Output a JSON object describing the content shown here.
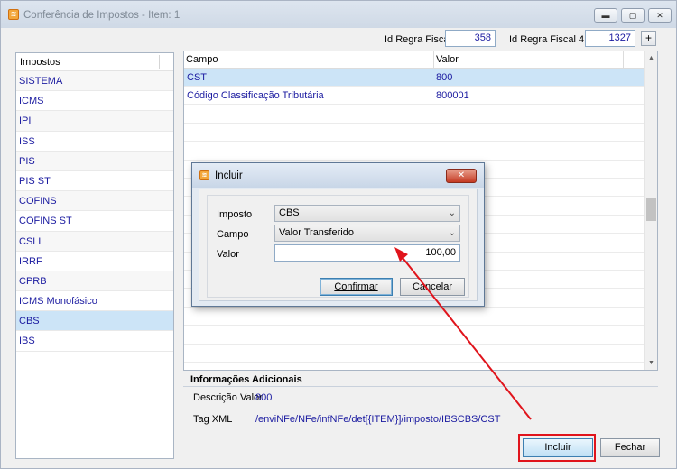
{
  "window": {
    "title": "Conferência de Impostos - Item: 1",
    "app_icon": "app-logo-icon",
    "controls": [
      "minimize-icon",
      "maximize-icon",
      "close-icon"
    ]
  },
  "top": {
    "regra_fiscal_label": "Id Regra Fiscal",
    "regra_fiscal_value": "358",
    "regra_fiscal_40_label": "Id Regra Fiscal 4.0",
    "regra_fiscal_40_value": "1327",
    "plus_label": "+"
  },
  "impostos": {
    "header": "Impostos",
    "items": [
      "SISTEMA",
      "ICMS",
      "IPI",
      "ISS",
      "PIS",
      "PIS ST",
      "COFINS",
      "COFINS ST",
      "CSLL",
      "IRRF",
      "CPRB",
      "ICMS Monofásico",
      "CBS",
      "IBS"
    ],
    "selected": "CBS"
  },
  "grid": {
    "col_campo": "Campo",
    "col_valor": "Valor",
    "rows": [
      {
        "campo": "CST",
        "valor": "800"
      },
      {
        "campo": "Código Classificação Tributária",
        "valor": "800001"
      }
    ]
  },
  "info": {
    "title": "Informações Adicionais",
    "descricao_label": "Descrição Valor",
    "descricao_value": "800",
    "tag_label": "Tag XML",
    "tag_value": "/enviNFe/NFe/infNFe/det[{ITEM}]/imposto/IBSCBS/CST"
  },
  "buttons": {
    "incluir": "Incluir",
    "fechar": "Fechar"
  },
  "dialog": {
    "title": "Incluir",
    "close_label": "✕",
    "imposto_label": "Imposto",
    "imposto_value": "CBS",
    "campo_label": "Campo",
    "campo_value": "Valor Transferido",
    "valor_label": "Valor",
    "valor_value": "100,00",
    "confirmar": "Confirmar",
    "cancelar": "Cancelar"
  },
  "colors": {
    "selection": "#cce4f7",
    "value_text": "#1a1aa0",
    "highlight_red": "#e0141c"
  }
}
